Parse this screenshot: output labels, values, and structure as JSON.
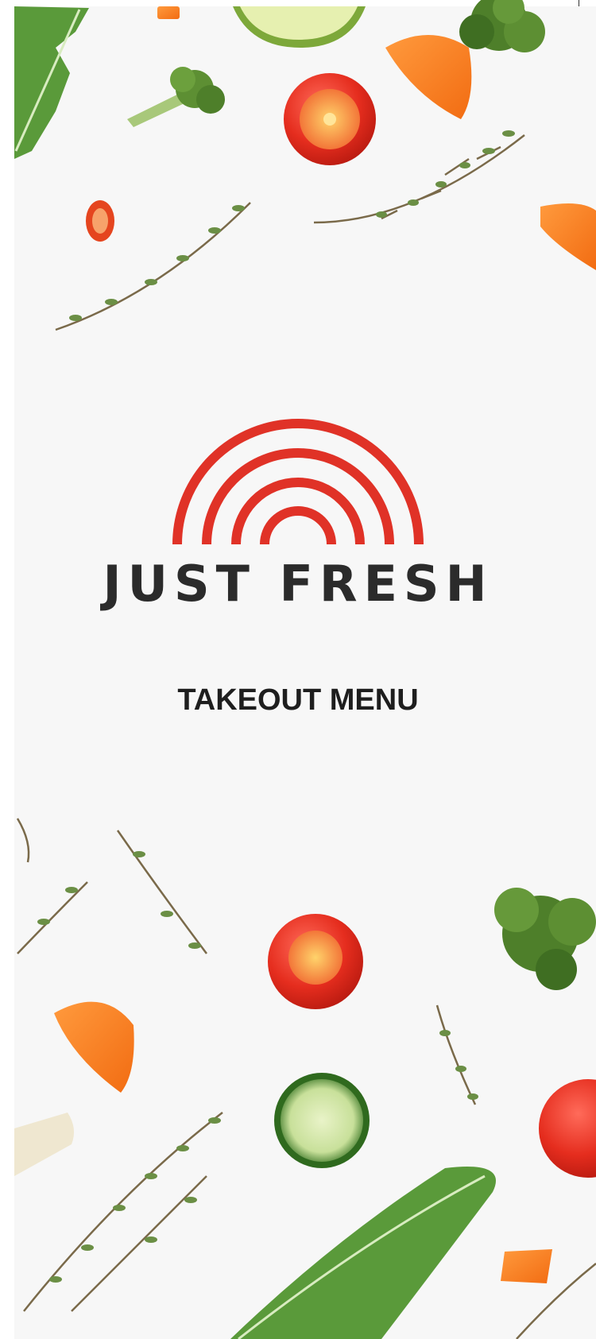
{
  "brand": {
    "name": "JUST FRESH",
    "logo_icon": "rainbow-arches-icon"
  },
  "menu": {
    "title": "TAKEOUT MENU"
  },
  "colors": {
    "logo_red": "#e03227",
    "text_dark": "#2b2b2b",
    "background": "#f7f7f7"
  },
  "decor_icons": [
    "arugula-leaf-icon",
    "lime-slice-icon",
    "broccoli-icon",
    "tomato-half-icon",
    "carrot-slice-icon",
    "thyme-sprig-icon",
    "chili-slice-icon",
    "cucumber-slice-icon",
    "garlic-icon"
  ]
}
